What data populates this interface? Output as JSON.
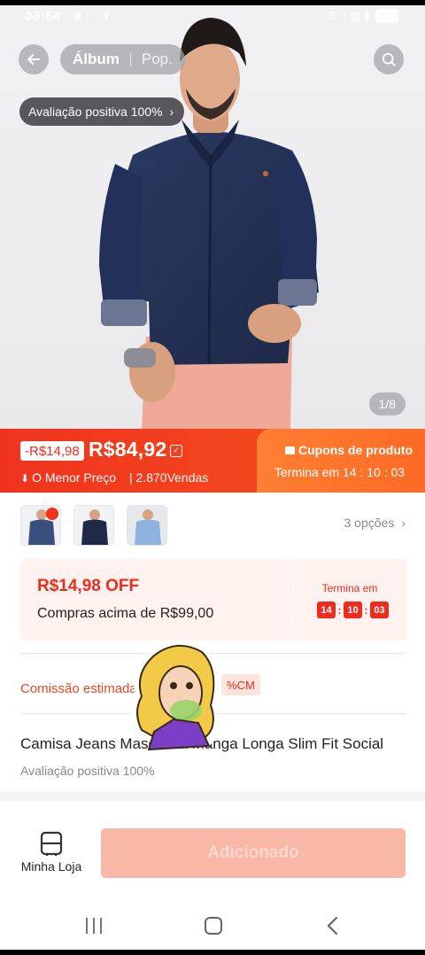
{
  "status_bar": {
    "time": "08:54"
  },
  "top_nav": {
    "tab_album": "Álbum",
    "tab_pop": "Pop."
  },
  "hero": {
    "rating_pill": "Avaliação positiva 100%",
    "page_counter": "1/8"
  },
  "price": {
    "discount_badge": "-R$14,98",
    "current_price": "R$84,92",
    "lowest_label": "O Menor Preço",
    "sales": "2.870Vendas",
    "coupons_title": "Cupons de produto",
    "coupon_ends": "Termina em 14 : 10 : 03"
  },
  "variants": {
    "options_label": "3 opções"
  },
  "coupon_card": {
    "amount": "R$14,98 OFF",
    "condition": "Compras acima de R$99,00",
    "ends_label": "Termina em",
    "timer": [
      "14",
      "10",
      "03"
    ]
  },
  "commission": {
    "label": "Comissão estimada",
    "badge": "%CM"
  },
  "product": {
    "title": "Camisa Jeans Masculina Manga Longa Slim Fit Social",
    "rating": "Avaliação positiva 100%"
  },
  "bottom": {
    "store_label": "Minha Loja",
    "add_button": "Adicionado"
  },
  "colors": {
    "primary": "#ee2b1c",
    "accent_orange": "#ff7f32",
    "button_disabled": "#f9b7a8"
  },
  "icons": [
    "back-arrow-icon",
    "search-icon",
    "chevron-right-icon",
    "down-arrow-icon",
    "ticket-icon",
    "store-icon",
    "nav-recent-icon",
    "nav-home-icon",
    "nav-back-icon"
  ]
}
